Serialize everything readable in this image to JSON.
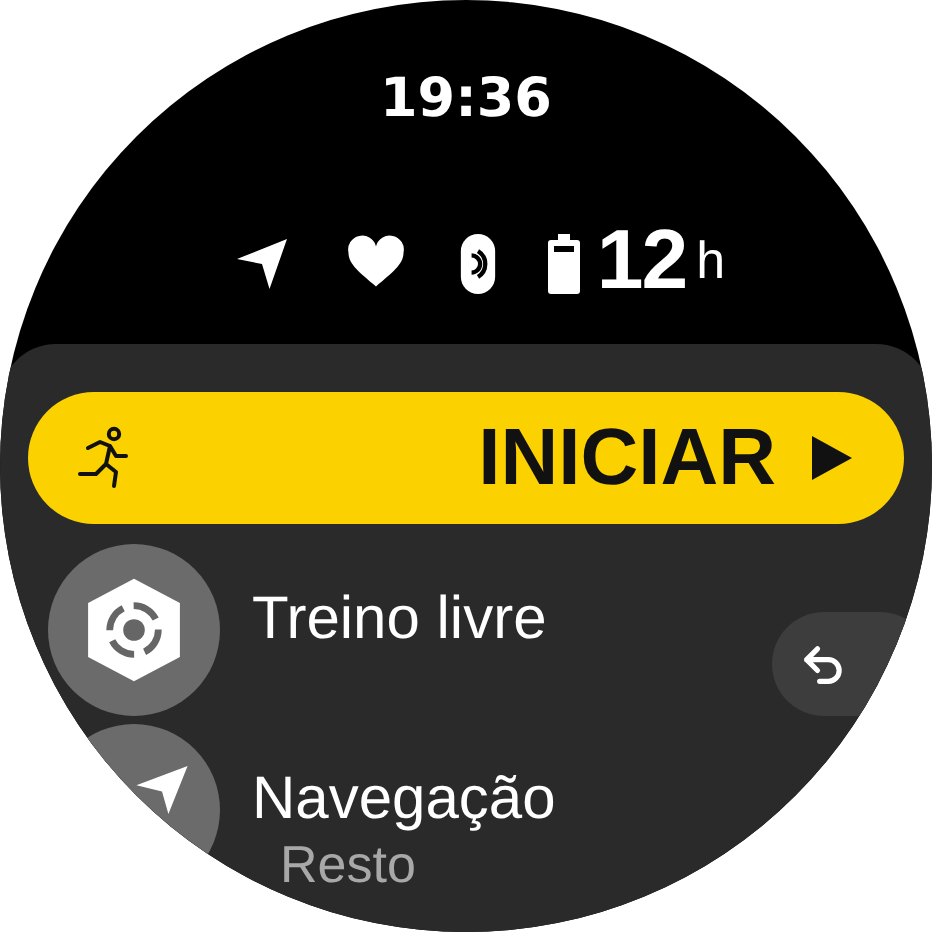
{
  "time": "19:36",
  "status": {
    "battery_hours": "12",
    "battery_unit": "h"
  },
  "start_button": {
    "label": "INICIAR"
  },
  "menu_items": [
    {
      "kind": "target",
      "title": "Treino livre"
    },
    {
      "kind": "navigation",
      "title": "Navegação",
      "subtitle": "Resto"
    }
  ]
}
